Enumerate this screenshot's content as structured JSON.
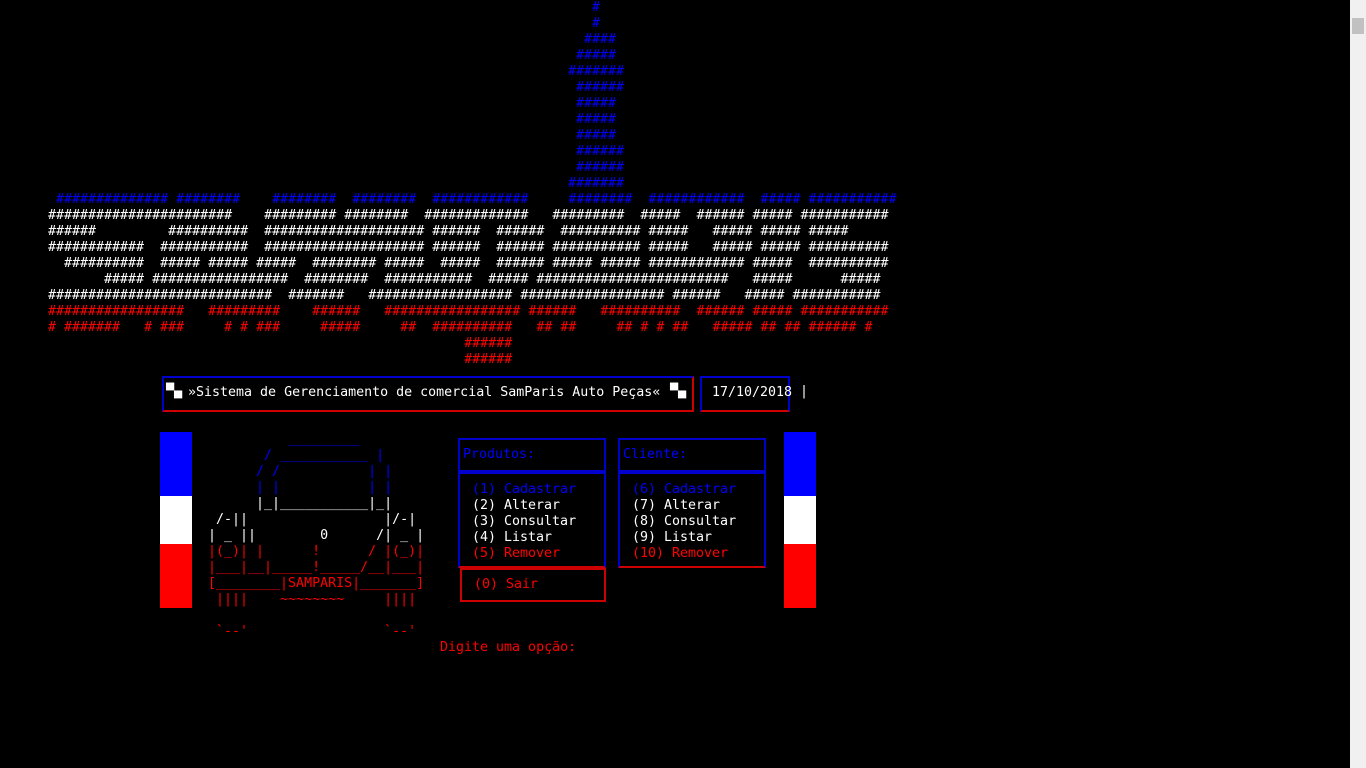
{
  "logo": {
    "tower_lines": [
      "#",
      "#",
      "####",
      "#####",
      "#######",
      "######",
      "#####",
      "#####",
      "#####",
      "######",
      "######",
      "#######"
    ],
    "blue_lines": [
      " ############## ########    ########  ########  ############     ########  ############  ##### ###########"
    ],
    "white_lines": [
      "#######################    ######### ########  #############   #########  #####  ###### ##### ###########",
      "######         ##########  #################### ######  ######  ########## #####   ##### ##### #####",
      "############  ###########  #################### ######  ###### ########### #####   ##### ##### ##########",
      "  ##########  ##### ##### #####  ######## #####  #####  ###### ##### ##### ############ #####  ##########",
      "       ##### #################  ########  ###########  ##### ########################   #####      #####",
      "############################  #######   ################## ################## ######   ##### ###########"
    ],
    "red_lines": [
      "#################   #########    ######   ################# ######   ##########  ###### ##### ###########",
      "# #######   # ###     # # ###     #####     ##  ##########   ## ##     ## # # ##   ##### ## ## ###### #",
      "                                                    ######",
      "                                                    ######"
    ]
  },
  "header": {
    "title": "»Sistema de Gerenciamento de comercial SamParis Auto Peças«",
    "left_glyph": "▀▄",
    "right_glyph": "▀▄",
    "date": "17/10/2018"
  },
  "car_art": {
    "blue": [
      "          _________",
      "       / ___________ |",
      "      / /           | |",
      "      | |           | |"
    ],
    "white": [
      "      |_|___________|_|",
      " /-||                 |/-|",
      "| _ ||        0      /| _ |"
    ],
    "red": [
      "|(_)| |      !      / |(_)|",
      "|___|__|_____!_____/__|___|",
      "[________|SAMPARIS|_______]",
      " ||||    ~~~~~~~~     ||||",
      "",
      " `--'                 `--'"
    ]
  },
  "menus": {
    "produtos": {
      "heading": "Produtos:",
      "items": [
        {
          "label": "(1) Cadastrar",
          "color": "#0000ff"
        },
        {
          "label": "(2) Alterar",
          "color": "#ffffff"
        },
        {
          "label": "(3) Consultar",
          "color": "#ffffff"
        },
        {
          "label": "(4) Listar",
          "color": "#ffffff"
        },
        {
          "label": "(5) Remover",
          "color": "#ff0000"
        }
      ],
      "exit_label": "(0) Sair"
    },
    "cliente": {
      "heading": "Cliente:",
      "items": [
        {
          "label": "(6) Cadastrar",
          "color": "#0000ff"
        },
        {
          "label": "(7) Alterar",
          "color": "#ffffff"
        },
        {
          "label": "(8) Consultar",
          "color": "#ffffff"
        },
        {
          "label": "(9) Listar",
          "color": "#ffffff"
        },
        {
          "label": "(10) Remover",
          "color": "#ff0000"
        }
      ]
    }
  },
  "prompt": "Digite uma opção:",
  "colors": {
    "blue": "#0000ff",
    "white": "#ffffff",
    "red": "#ff0000",
    "background": "#000000"
  }
}
